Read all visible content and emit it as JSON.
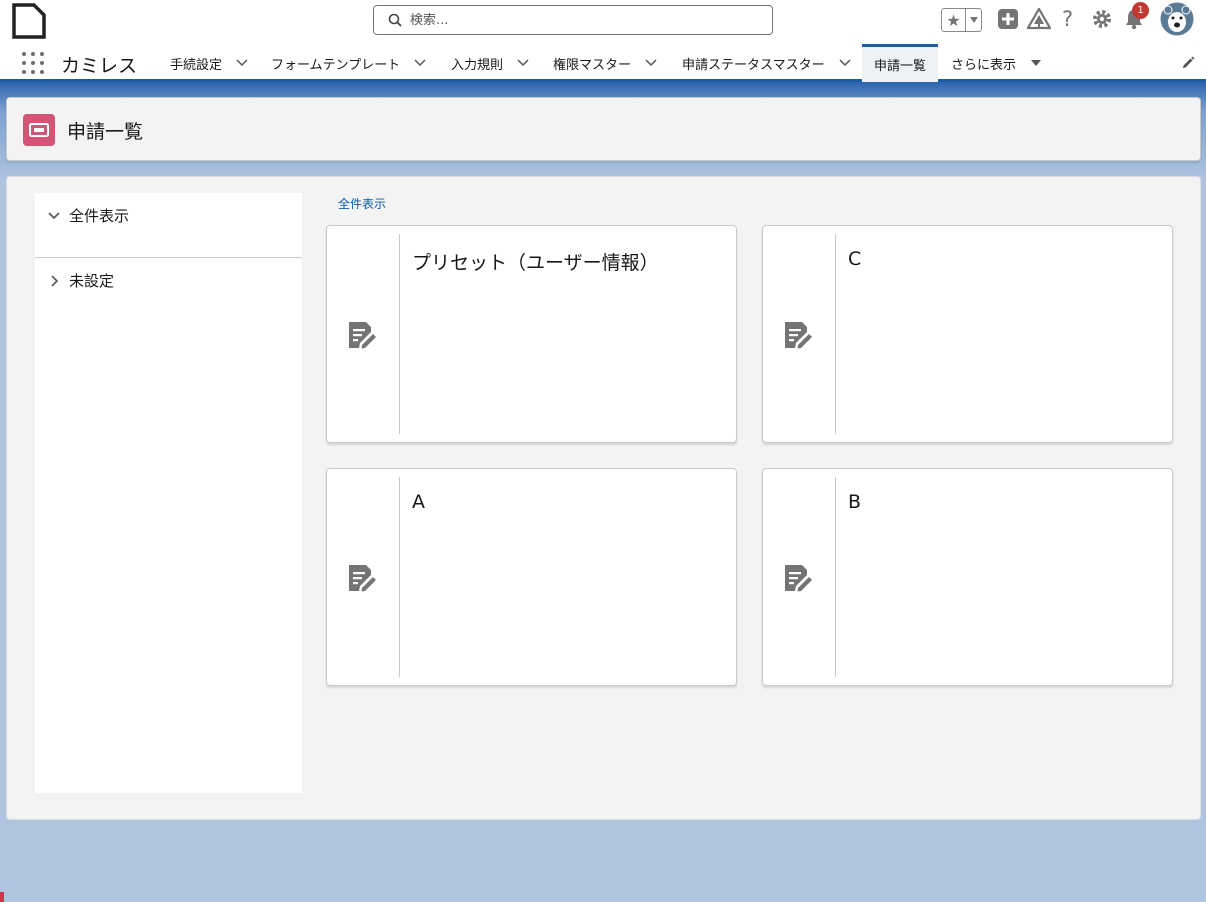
{
  "header": {
    "search_placeholder": "検索...",
    "notification_count": "1",
    "icons": [
      "document-icon",
      "search-icon",
      "star-icon",
      "chevron-down-icon",
      "add-icon",
      "trailhead-icon",
      "help-icon",
      "settings-icon",
      "bell-icon",
      "avatar"
    ]
  },
  "nav": {
    "app_name": "カミレス",
    "items": [
      {
        "label": "手続設定"
      },
      {
        "label": "フォームテンプレート"
      },
      {
        "label": "入力規則"
      },
      {
        "label": "権限マスター"
      },
      {
        "label": "申請ステータスマスター"
      },
      {
        "label": "申請一覧"
      },
      {
        "label": "さらに表示"
      }
    ]
  },
  "page": {
    "title": "申請一覧",
    "accent_color": "#d35475"
  },
  "left_panel": {
    "items": [
      {
        "label": "全件表示"
      },
      {
        "label": "未設定"
      }
    ]
  },
  "main": {
    "breadcrumb": "全件表示",
    "cards": [
      {
        "title": "プリセット（ユーザー情報）"
      },
      {
        "title": "C"
      },
      {
        "title": "A"
      },
      {
        "title": "B"
      }
    ]
  }
}
